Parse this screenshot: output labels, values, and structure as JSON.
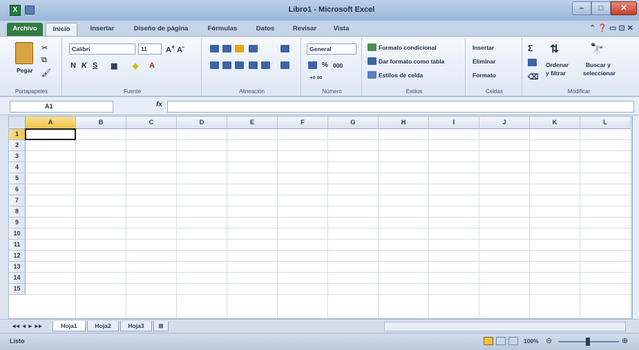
{
  "window": {
    "title": "Libro1 - Microsoft Excel"
  },
  "tabs": [
    "Archivo",
    "Inicio",
    "Insertar",
    "Diseño de página",
    "Fórmulas",
    "Datos",
    "Revisar",
    "Vista"
  ],
  "ribbon": {
    "portapapeles": {
      "pegar": "Pegar",
      "label": "Portapapeles"
    },
    "fuente": {
      "font": "Calibri",
      "size": "11",
      "label": "Fuente"
    },
    "alineacion": {
      "label": "Alineación"
    },
    "numero": {
      "format": "General",
      "percent": "%",
      "thousands": "000",
      "label": "Número"
    },
    "estilos": {
      "formato_condicional": "Formato condicional",
      "dar_formato_tabla": "Dar formato como tabla",
      "estilos_celda": "Estilos de celda",
      "label": "Estilos"
    },
    "celdas": {
      "insertar": "Insertar",
      "eliminar": "Eliminar",
      "formato": "Formato",
      "label": "Celdas"
    },
    "modificar": {
      "ordenar_1": "Ordenar",
      "ordenar_2": "y filtrar",
      "buscar_1": "Buscar y",
      "buscar_2": "seleccionar",
      "label": "Modificar"
    }
  },
  "formula_bar": {
    "name_box": "A1",
    "fx": "fx",
    "value": ""
  },
  "grid": {
    "columns": [
      "A",
      "B",
      "C",
      "D",
      "E",
      "F",
      "G",
      "H",
      "I",
      "J",
      "K",
      "L"
    ],
    "rows": [
      "1",
      "2",
      "3",
      "4",
      "5",
      "6",
      "7",
      "8",
      "9",
      "10",
      "11",
      "12",
      "13",
      "14",
      "15"
    ],
    "active_cell": "A1"
  },
  "sheets": [
    "Hoja1",
    "Hoja2",
    "Hoja3"
  ],
  "status": {
    "text": "Listo",
    "zoom": "100%"
  }
}
